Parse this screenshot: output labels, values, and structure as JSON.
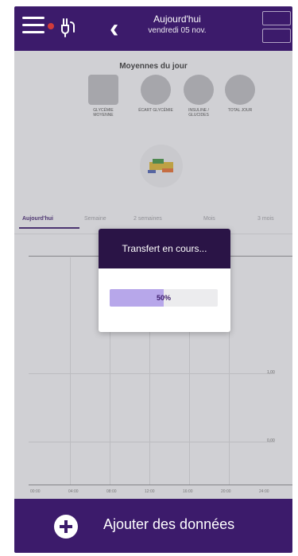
{
  "header": {
    "title": "Aujourd'hui",
    "subtitle": "vendredi 05 nov."
  },
  "averages": {
    "title": "Moyennes du jour",
    "items": [
      {
        "label": "GLYCÉMIE MOYENNE",
        "shape": "square"
      },
      {
        "label": "ÉCART GLYCÉMIE",
        "shape": "round"
      },
      {
        "label": "INSULINE / GLUCIDES",
        "shape": "round"
      },
      {
        "label": "TOTAL JOUR",
        "shape": "round"
      }
    ]
  },
  "tabs": [
    "Aujourd'hui",
    "Semaine",
    "2 semaines",
    "Mois",
    "3 mois"
  ],
  "chart": {
    "y_ticks": [
      "1,00",
      "0,00"
    ],
    "x_ticks": [
      "00:00",
      "04:00",
      "08:00",
      "12:00",
      "16:00",
      "20:00",
      "24:00"
    ]
  },
  "dialog": {
    "title": "Transfert en cours...",
    "progress_label": "50%",
    "progress_value": 0.5
  },
  "bottom": {
    "label": "Ajouter des données"
  },
  "colors": {
    "primary": "#3c1b6b",
    "dialog_header": "#2a1446",
    "progress_fill": "#b7a7ea"
  },
  "icons": {
    "menu": "menu-icon",
    "plug": "plug-icon",
    "back": "chevron-left-icon",
    "add": "plus-circle-icon"
  }
}
